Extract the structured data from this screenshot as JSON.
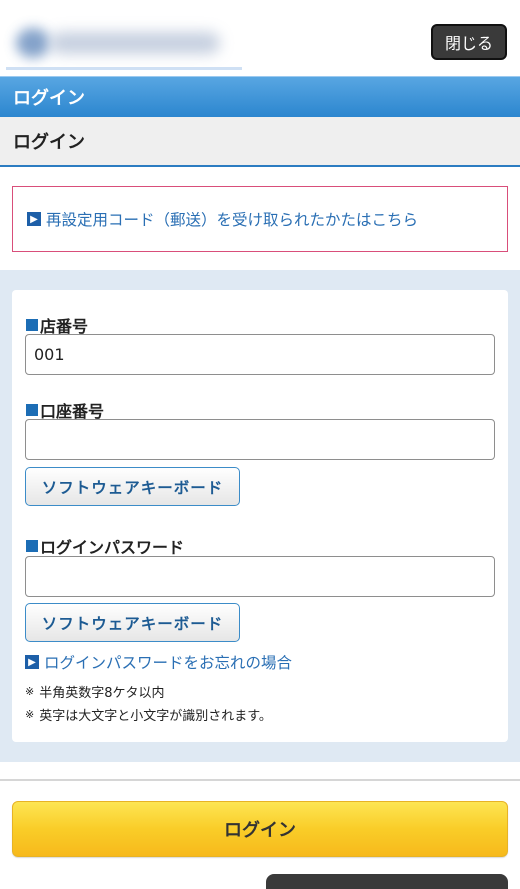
{
  "header": {
    "close_label": "閉じる"
  },
  "title_bar": {
    "label": "ログイン"
  },
  "sub_bar": {
    "label": "ログイン"
  },
  "notice": {
    "link_text": "再設定用コード（郵送）を受け取られたかたはこちら"
  },
  "form": {
    "branch": {
      "label": "店番号",
      "value": "001"
    },
    "account": {
      "label": "口座番号",
      "value": ""
    },
    "password": {
      "label": "ログインパスワード",
      "value": ""
    },
    "software_keyboard_label": "ソフトウェアキーボード",
    "forgot_link": "ログインパスワードをお忘れの場合",
    "notes": [
      "半角英数字8ケタ以内",
      "英字は大文字と小文字が識別されます。"
    ],
    "note_mark": "※"
  },
  "login_button": {
    "label": "ログイン"
  },
  "colors": {
    "title_bar": "#2c86cf",
    "accent_link": "#2a6fb4",
    "notice_border": "#d94e7a",
    "login_button": "#f9cd28"
  }
}
